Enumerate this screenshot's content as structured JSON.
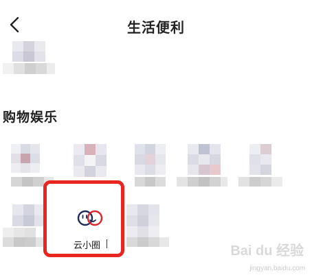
{
  "header": {
    "title": "生活便利",
    "back_icon": "chevron-left-icon"
  },
  "sections": [
    {
      "title": "购物娱乐"
    }
  ],
  "highlighted_app": {
    "label": "云小圈",
    "icon": "yunxiaoquan-logo-icon",
    "highlight_color": "#e8261f",
    "logo_colors": {
      "left_ring": "#1b2a5a",
      "right_ring": "#d8262b"
    }
  },
  "watermark": {
    "logo": "Bai du 经验",
    "url": "jingyan.baidu.com"
  }
}
